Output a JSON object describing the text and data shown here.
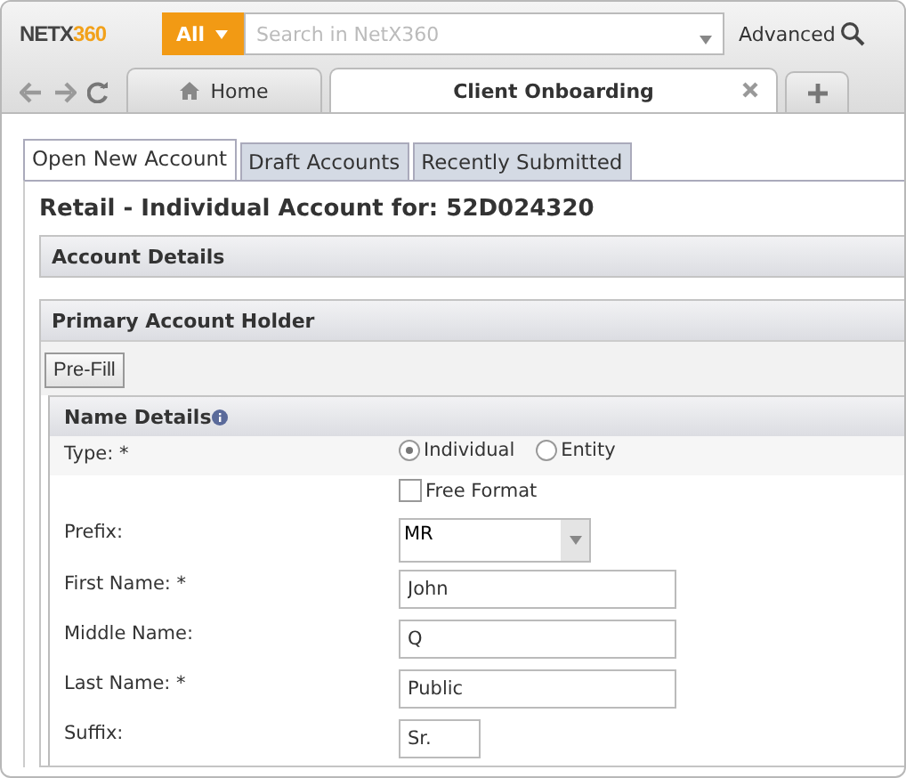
{
  "header": {
    "logo_prefix": "NETX",
    "logo_suffix": "360",
    "scope_button": "All",
    "search": {
      "placeholder": "Search in NetX360"
    },
    "advanced_link": "Advanced"
  },
  "browser_tabs": [
    {
      "label": "Home",
      "selected": false,
      "kind": "home"
    },
    {
      "label": "Client Onboarding",
      "selected": true,
      "kind": "closable"
    }
  ],
  "page_tabs": [
    {
      "label": "Open New Account",
      "selected": true
    },
    {
      "label": "Draft Accounts",
      "selected": false
    },
    {
      "label": "Recently Submitted",
      "selected": false
    }
  ],
  "title": "Retail - Individual Account for: 52D024320",
  "sections": [
    {
      "title": "Account Details"
    },
    {
      "title": "Primary Account Holder"
    }
  ],
  "prefill_button": "Pre-Fill",
  "name_details": {
    "title": "Name Details",
    "rows": [
      {
        "kind": "radio",
        "label": "Type: *",
        "options": [
          {
            "label": "Individual",
            "selected": true
          },
          {
            "label": "Entity",
            "selected": false
          }
        ]
      },
      {
        "kind": "checkbox",
        "option": "Free Format",
        "checked": false
      },
      {
        "kind": "select",
        "label": "Prefix:",
        "value": "MR"
      },
      {
        "kind": "text",
        "label": "First Name: *",
        "value": "John"
      },
      {
        "kind": "text",
        "label": "Middle Name:",
        "value": "Q"
      },
      {
        "kind": "text",
        "label": "Last Name: *",
        "value": "Public"
      },
      {
        "kind": "short_text",
        "label": "Suffix:",
        "value": "Sr."
      }
    ]
  }
}
